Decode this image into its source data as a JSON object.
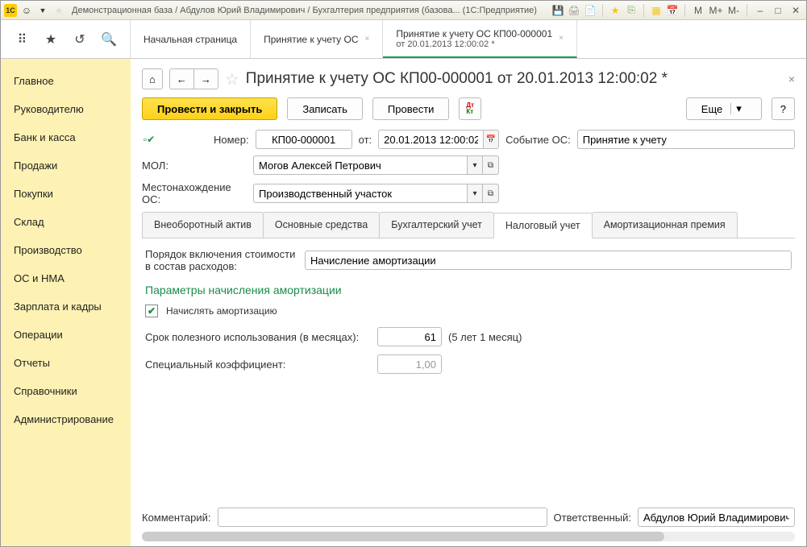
{
  "titlebar": {
    "text": "Демонстрационная база / Абдулов Юрий Владимирович / Бухгалтерия предприятия (базова... (1С:Предприятие)",
    "m_labels": [
      "M",
      "M+",
      "M-"
    ]
  },
  "top_tabs": {
    "start_page": "Начальная страница",
    "tab1": "Принятие к учету ОС",
    "tab2_line1": "Принятие к учету ОС КП00-000001",
    "tab2_line2": "от 20.01.2013 12:00:02 *"
  },
  "sidebar": {
    "items": [
      "Главное",
      "Руководителю",
      "Банк и касса",
      "Продажи",
      "Покупки",
      "Склад",
      "Производство",
      "ОС и НМА",
      "Зарплата и кадры",
      "Операции",
      "Отчеты",
      "Справочники",
      "Администрирование"
    ]
  },
  "document": {
    "title": "Принятие к учету ОС КП00-000001 от 20.01.2013 12:00:02 *",
    "commands": {
      "post_and_close": "Провести и закрыть",
      "save": "Записать",
      "post": "Провести",
      "more": "Еще",
      "help": "?"
    },
    "labels": {
      "number": "Номер:",
      "from": "от:",
      "event": "Событие ОС:",
      "mol": "МОЛ:",
      "location": "Местонахождение ОС:",
      "cost_order": "Порядок включения стоимости в состав расходов:",
      "useful_life": "Срок полезного использования (в месяцах):",
      "useful_life_hint": "(5 лет 1 месяц)",
      "special_coef": "Специальный коэффициент:",
      "calc_deprec": "Начислять амортизацию",
      "comment": "Комментарий:",
      "responsible": "Ответственный:"
    },
    "values": {
      "number": "КП00-000001",
      "date": "20.01.2013 12:00:02",
      "event": "Принятие к учету",
      "mol": "Могов Алексей Петрович",
      "location": "Производственный участок",
      "cost_order": "Начисление амортизации",
      "useful_life": "61",
      "special_coef": "1,00",
      "comment": "",
      "responsible": "Абдулов Юрий Владимирович"
    },
    "section_title": "Параметры начисления амортизации",
    "tabs": [
      "Внеоборотный актив",
      "Основные средства",
      "Бухгалтерский учет",
      "Налоговый учет",
      "Амортизационная премия"
    ],
    "active_tab_index": 3
  }
}
